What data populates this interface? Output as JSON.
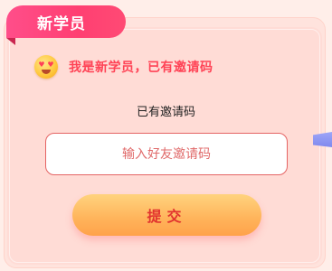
{
  "badge": {
    "label": "新学员"
  },
  "headline": {
    "emoji": "heart-eyes-emoji-icon",
    "text": "我是新学员，已有邀请码"
  },
  "subtitle": "已有邀请码",
  "invite_input": {
    "placeholder": "输入好友邀请码",
    "value": ""
  },
  "submit_button": {
    "label": "提交"
  },
  "colors": {
    "badge_bg": "#ff4a7a",
    "headline_text": "#ff4356",
    "input_border": "#e56464",
    "button_bg": "#ffb35a",
    "button_text": "#e2342e",
    "side_tab": "#8a93f2"
  }
}
